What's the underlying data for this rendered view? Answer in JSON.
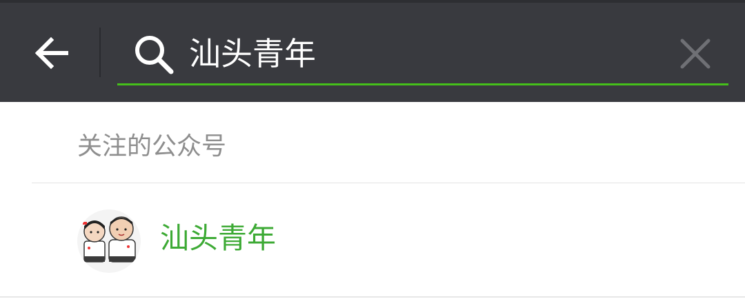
{
  "header": {
    "back_icon": "arrow-left-icon",
    "search": {
      "icon": "search-icon",
      "value": "汕头青年",
      "placeholder": "",
      "clear_icon": "close-icon",
      "accent_color": "#45c01a"
    },
    "background_color": "#393a3f"
  },
  "section": {
    "title": "关注的公众号"
  },
  "results": [
    {
      "name": "汕头青年",
      "name_color": "#3daa35",
      "avatar": "cartoon-couple-avatar"
    }
  ]
}
